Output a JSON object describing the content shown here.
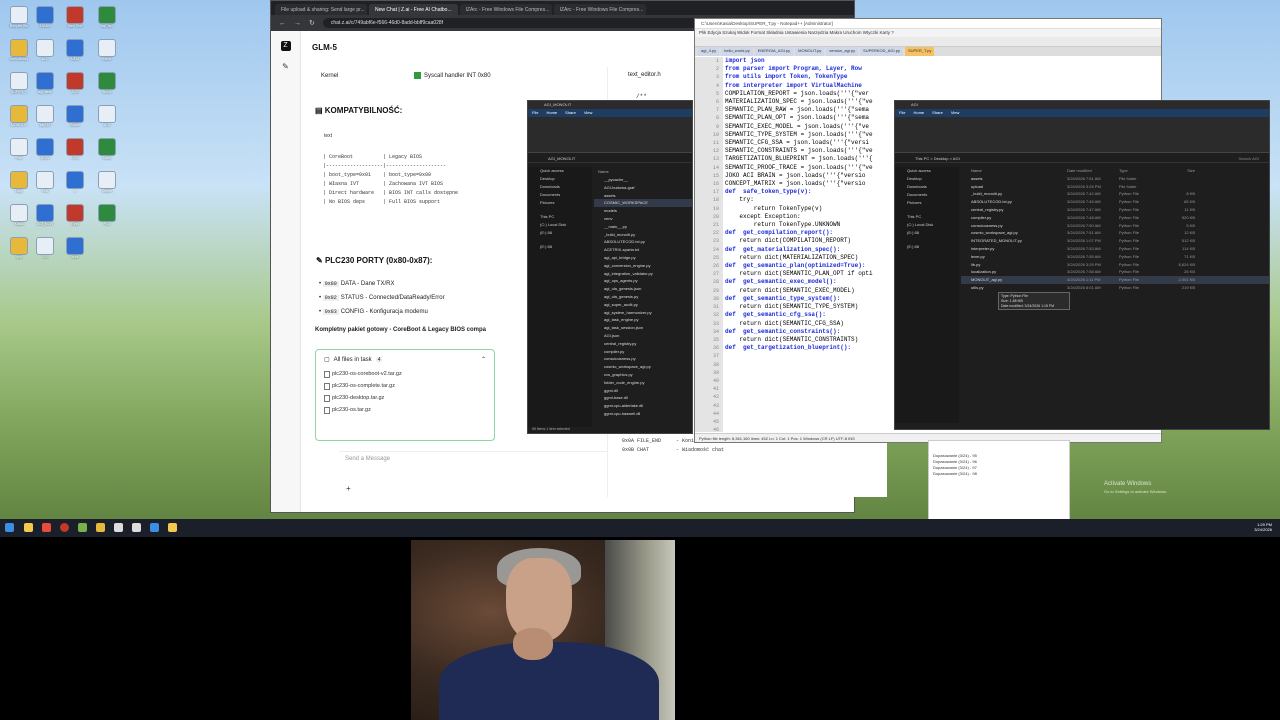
{
  "browser": {
    "tabs": [
      "File upload & sharing: Send large pr...",
      "New Chat | Z.ai - Free AI Chatbo...",
      "IZArc - Free Windows File Compres...",
      "IZArc - Free Windows File Compres..."
    ],
    "url": "chat.z.ai/c/749abf6e-f566-46d0-8add-bbff9caa028f"
  },
  "chat": {
    "model": "GLM-5",
    "kernel_label": "Kernel",
    "kernel_value": "Syscall handler INT 0x80",
    "compat_title": "KOMPATYBILNOŚĆ:",
    "text_label": "text",
    "compat_table": "| CoreBoot          | Legacy BIOS\n|-------------------|--------------------\n| boot_type=0x01    | boot_type=0x00\n| Własna IVT        | Zachowana IVT BIOS\n| Direct hardware   | BIOS INT calls dostępne\n| No BIOS deps      | Full BIOS support",
    "ports_title": "PLC230 PORTY (0x80-0x87):",
    "ports": [
      {
        "code": "0x80",
        "text": "DATA - Dane TX/RX"
      },
      {
        "code": "0x82",
        "text": "STATUS - Connected/DataReady/Error"
      },
      {
        "code": "0x83",
        "text": "CONFIG - Konfiguracja modemu"
      }
    ],
    "summary": "Kompletny pakiet gotowy - CoreBoot & Legacy BIOS compa",
    "files_header": "All files in task",
    "files_count": "4",
    "files": [
      "plc230-os-coreboot-v2.tar.gz",
      "plc230-os-complete.tar.gz",
      "plc230-desktop.tar.gz",
      "plc230-os.tar.gz"
    ],
    "input_placeholder": "Send a Message",
    "editor_filename": "text_editor.h",
    "editor_first_line": "/**",
    "editor_bottom": "0x0A FILE_END     - Koniec\n0x0B CHAT         - Wiadomość chat"
  },
  "notepad": {
    "title": "C:\\Users\\Kasia\\Desktop\\SUPER_T.py - Notepad++ [Administrator]",
    "menu": "Plik  Edycja  Szukaj  Widok  Format  Składnia  Ustawienia  Narzędzia  Makra  Uruchom  Wtyczki  Karty  ?",
    "tabs": [
      "agi_4.py",
      "hello_world.py",
      "ENERGIA_AGI.py",
      "MONOLIT.py",
      "version_agi.py",
      "SUPERKOD_AGI.py",
      "SUPER_T.py"
    ],
    "line_numbers": [
      "1",
      "2",
      "3",
      "4",
      "5",
      "6",
      "7",
      "8",
      "9",
      "10",
      "11",
      "12",
      "13",
      "14",
      "15",
      "16",
      "17",
      "18",
      "19",
      "20",
      "21",
      "22",
      "23",
      "24",
      "25",
      "26",
      "27",
      "28",
      "29",
      "30",
      "31",
      "32",
      "33",
      "34",
      "35",
      "36",
      "37",
      "38",
      "39",
      "40",
      "41",
      "42",
      "43",
      "44",
      "45",
      "46"
    ],
    "code": [
      "import json",
      "from parser import Program, Layer, Row",
      "from utils import Token, TokenType",
      "from interpreter import VirtualMachine",
      "",
      "COMPILATION_REPORT = json.loads('''{\"ver",
      "MATERIALIZATION_SPEC = json.loads('''{\"ve",
      "SEMANTIC_PLAN_RAW = json.loads('''{\"sema",
      "SEMANTIC_PLAN_OPT = json.loads('''{\"sema",
      "SEMANTIC_EXEC_MODEL = json.loads('''{\"ve",
      "SEMANTIC_TYPE_SYSTEM = json.loads('''{\"ve",
      "SEMANTIC_CFG_SSA = json.loads('''{\"versi",
      "SEMANTIC_CONSTRAINTS = json.loads('''{\"ve",
      "TARGETIZATION_BLUEPRINT = json.loads('''{",
      "SEMANTIC_PROOF_TRACE = json.loads('''{\"ve",
      "JOKO ACI BRAIN = json.loads('''{\"versio",
      "CONCEPT_MATRIX = json.loads('''{\"versio",
      "",
      "def  safe_token_type(v):",
      "    try:",
      "        return TokenType(v)",
      "    except Exception:",
      "        return TokenType.UNKNOWN",
      "",
      "",
      "def  get_compilation_report():",
      "    return dict(COMPILATION_REPORT)",
      "",
      "def  get_materialization_spec():",
      "    return dict(MATERIALIZATION_SPEC)",
      "",
      "def  get_semantic_plan(optimized=True):",
      "    return dict(SEMANTIC_PLAN_OPT if opti",
      "",
      "def  get_semantic_exec_model():",
      "    return dict(SEMANTIC_EXEC_MODEL)",
      "",
      "def  get_semantic_type_system():",
      "    return dict(SEMANTIC_TYPE_SYSTEM)",
      "",
      "def  get_semantic_cfg_ssa():",
      "    return dict(SEMANTIC_CFG_SSA)",
      "",
      "def  get_semantic_constraints():",
      "    return dict(SEMANTIC_CONSTRAINTS)",
      "",
      "def  get_targetization_blueprint():"
    ],
    "status": "Python file     length: 8,361,160   lines: 452        Ln: 1   Col: 1   Pos: 1        Windows (CR LF)   UTF-8   INS"
  },
  "explorer1": {
    "title": "AGI_MONOLIT",
    "ribbon_tabs": [
      "File",
      "Home",
      "Share",
      "View"
    ],
    "path": "AGI_MONOLIT",
    "nav": [
      "Quick access",
      "Desktop",
      "Downloads",
      "Documents",
      "Pictures",
      "",
      "This PC",
      "(C:) Local Disk",
      "(E:) 88",
      "",
      "(E:) 88"
    ],
    "name_header": "Name",
    "files": [
      "__pycache__",
      "AGI-budowa-graf",
      "assets",
      "COSMIC_WORKSPACE",
      "models",
      "venv",
      "__main__.py",
      "_build_monolit.py",
      "ABSOLUTECOD.txt.py",
      "ACETRIX-sparta.txt",
      "agi_api_bridge.py",
      "agi_conversion_engine.py",
      "agi_integration_validator.py",
      "agi_ops_agents.py",
      "agi_ola_genesis.json",
      "agi_ola_genesis.py",
      "agi_super_audit.py",
      "agi_system_harmonizer.py",
      "agi_task_engine.py",
      "agi_task_session.json",
      "AGI.json",
      "central_registry.py",
      "compiler.py",
      "consciousness.py",
      "cosmic_workspace_agi.py",
      "cvs_graphics.py",
      "folder_code_engine.py",
      "ggml.dll",
      "ggml-base.dll",
      "ggml-cpu-alderlake.dll",
      "ggml-cpu-haswell.dll"
    ],
    "status": "96 items    1 item selected"
  },
  "explorer2": {
    "title": "AGI",
    "ribbon_tabs": [
      "File",
      "Home",
      "Share",
      "View"
    ],
    "path": "This PC  >  Desktop  >  AGI",
    "search": "Search AGI",
    "nav": [
      "Quick access",
      "Desktop",
      "Downloads",
      "Documents",
      "Pictures",
      "",
      "This PC",
      "(C:) Local Disk",
      "(E:) 88",
      "",
      "(E:) 88"
    ],
    "headers": [
      "Name",
      "Date modified",
      "Type",
      "Size"
    ],
    "rows": [
      {
        "n": "assets",
        "d": "3/24/2026 7:51 AM",
        "t": "File folder",
        "s": ""
      },
      {
        "n": "upload",
        "d": "3/24/2026 3:26 PM",
        "t": "File folder",
        "s": ""
      },
      {
        "n": "_build_monolit.py",
        "d": "3/24/2026 7:42 AM",
        "t": "Python File",
        "s": "8 KB"
      },
      {
        "n": "ABSOLUTECOD.txt.py",
        "d": "3/24/2026 7:45 AM",
        "t": "Python File",
        "s": "65 KB"
      },
      {
        "n": "central_registry.py",
        "d": "3/24/2026 7:47 AM",
        "t": "Python File",
        "s": "11 KB"
      },
      {
        "n": "compiler.py",
        "d": "3/24/2026 7:48 AM",
        "t": "Python File",
        "s": "520 KB"
      },
      {
        "n": "consciousness.py",
        "d": "3/24/2026 7:50 AM",
        "t": "Python File",
        "s": "5 KB"
      },
      {
        "n": "cosmic_workspace_agi.py",
        "d": "3/24/2026 7:51 AM",
        "t": "Python File",
        "s": "12 KB"
      },
      {
        "n": "INTEGRATED_MONOLIT.py",
        "d": "3/24/2026 1:07 PM",
        "t": "Python File",
        "s": "512 KB"
      },
      {
        "n": "interpreter.py",
        "d": "3/24/2026 7:53 AM",
        "t": "Python File",
        "s": "114 KB"
      },
      {
        "n": "lexer.py",
        "d": "3/24/2026 7:55 AM",
        "t": "Python File",
        "s": "71 KB"
      },
      {
        "n": "lib.py",
        "d": "3/24/2026 3:29 PM",
        "t": "Python File",
        "s": "8,624 KB"
      },
      {
        "n": "localization.py",
        "d": "3/24/2026 7:58 AM",
        "t": "Python File",
        "s": "26 KB"
      },
      {
        "n": "MONOLIT_agi.py",
        "d": "3/24/2026 1:11 PM",
        "t": "Python File",
        "s": "2,001 KB"
      },
      {
        "n": "utils.py",
        "d": "3/24/2026 8:01 AM",
        "t": "Python File",
        "s": "219 KB"
      }
    ],
    "tooltip": "Type: Python File\nSize: 1.88 MB\nDate modified: 3/24/2026 1:15 PM"
  },
  "background_window": [
    "Dopasowanie (3/24) - 95",
    "Dopasowanie (3/24) - 96",
    "Dopasowanie (3/24) - 97",
    "Dopasowanie (3/24) - 98"
  ],
  "activate": {
    "line1": "Activate Windows",
    "line2": "Go to Settings to activate Windows."
  },
  "taskbar": {
    "time": "1:29 PM",
    "date": "3/24/2026"
  },
  "desktop_icons": [
    "Recycle Bin",
    "ADMIN",
    "New Text",
    "agi_api",
    "dom-obrazy",
    "ALL",
    "MEM",
    "Menu",
    "SUPER_T",
    "agi_desk",
    "ACE",
    "Nowy",
    "MONOLIT",
    "plc230",
    "Brave",
    "AGI",
    "Foto",
    "DOW",
    "LOG",
    "Dane",
    "Nagr",
    "Test",
    "x",
    "Steam",
    "Kasia",
    "AGI_MON",
    "Dysk",
    "PLC",
    "sys",
    "OS",
    "boot"
  ]
}
